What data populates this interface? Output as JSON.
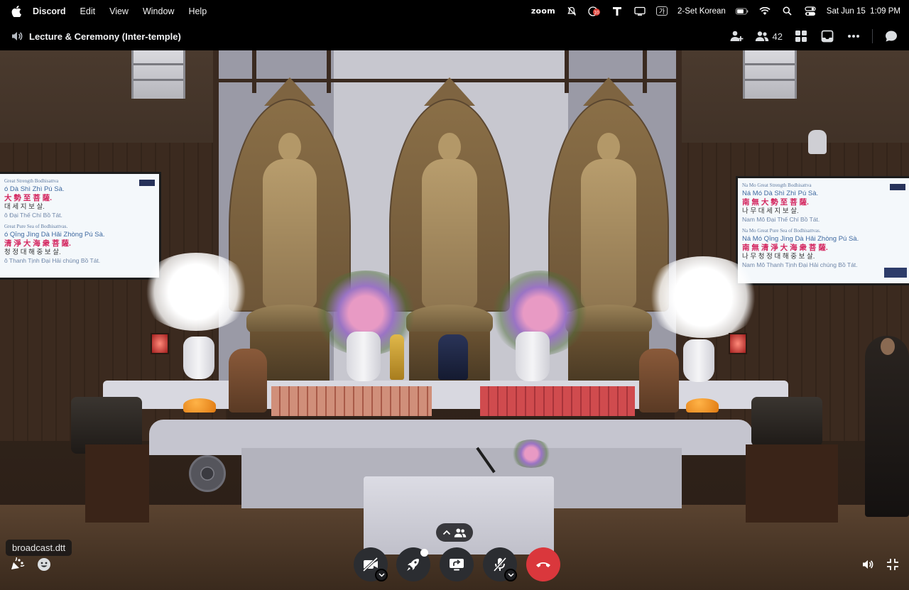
{
  "menubar": {
    "app_name": "Discord",
    "menus": [
      "Edit",
      "View",
      "Window",
      "Help"
    ],
    "zoom_label": "zoom",
    "input_source": "2-Set Korean",
    "datetime": "Sat Jun 15  1:09 PM",
    "notification_count": "10"
  },
  "window": {
    "channel_title": "Lecture & Ceremony (Inter-temple)",
    "participant_count": "42"
  },
  "stream": {
    "streamer_name": "broadcast.dtt",
    "left_screen": {
      "heading_1": "Great Strength Bodhisattva",
      "pinyin_1": "ó Dà Shì Zhì Pú Sà.",
      "chinese_1": "大 勢 至 菩 薩.",
      "korean_1": "대 세 지 보 살.",
      "viet_1": "ô Đại Thế Chí Bồ Tát.",
      "heading_2": "Great Pure Sea of Bodhisattvas.",
      "pinyin_2": "ó Qīng Jìng Dà Hǎi Zhòng Pú Sà.",
      "chinese_2": "清 淨 大 海 衆 菩 薩.",
      "korean_2": "청 정 대 해 중 보 살.",
      "viet_2": "ô Thanh Tịnh Đại Hải chúng Bồ Tát."
    },
    "right_screen": {
      "heading_1": "Na Mo Great Strength Bodhisattva",
      "pinyin_1": "Ná Mó Dà Shì Zhì Pú Sà.",
      "chinese_1": "南 無 大 勢 至 菩 薩.",
      "korean_1": "나 무 대 세 지 보 살.",
      "viet_1": "Nam Mô Đại Thế Chí Bồ Tát.",
      "heading_2": "Na Mo Great Pure Sea of Bodhisattvas.",
      "pinyin_2": "Ná Mó Qīng Jìng Dà Hǎi Zhòng Pú Sà.",
      "chinese_2": "南 無 清 淨 大 海 衆 菩 薩.",
      "korean_2": "나 무 청 정 대 해 중 보 살.",
      "viet_2": "Nam Mô Thanh Tịnh Đại Hải chúng Bồ Tát."
    }
  },
  "controls": {
    "buttons": [
      "camera-off",
      "activities",
      "screen-share",
      "mute",
      "disconnect"
    ],
    "end_color": "#da373c",
    "button_color": "#2b2d31"
  }
}
